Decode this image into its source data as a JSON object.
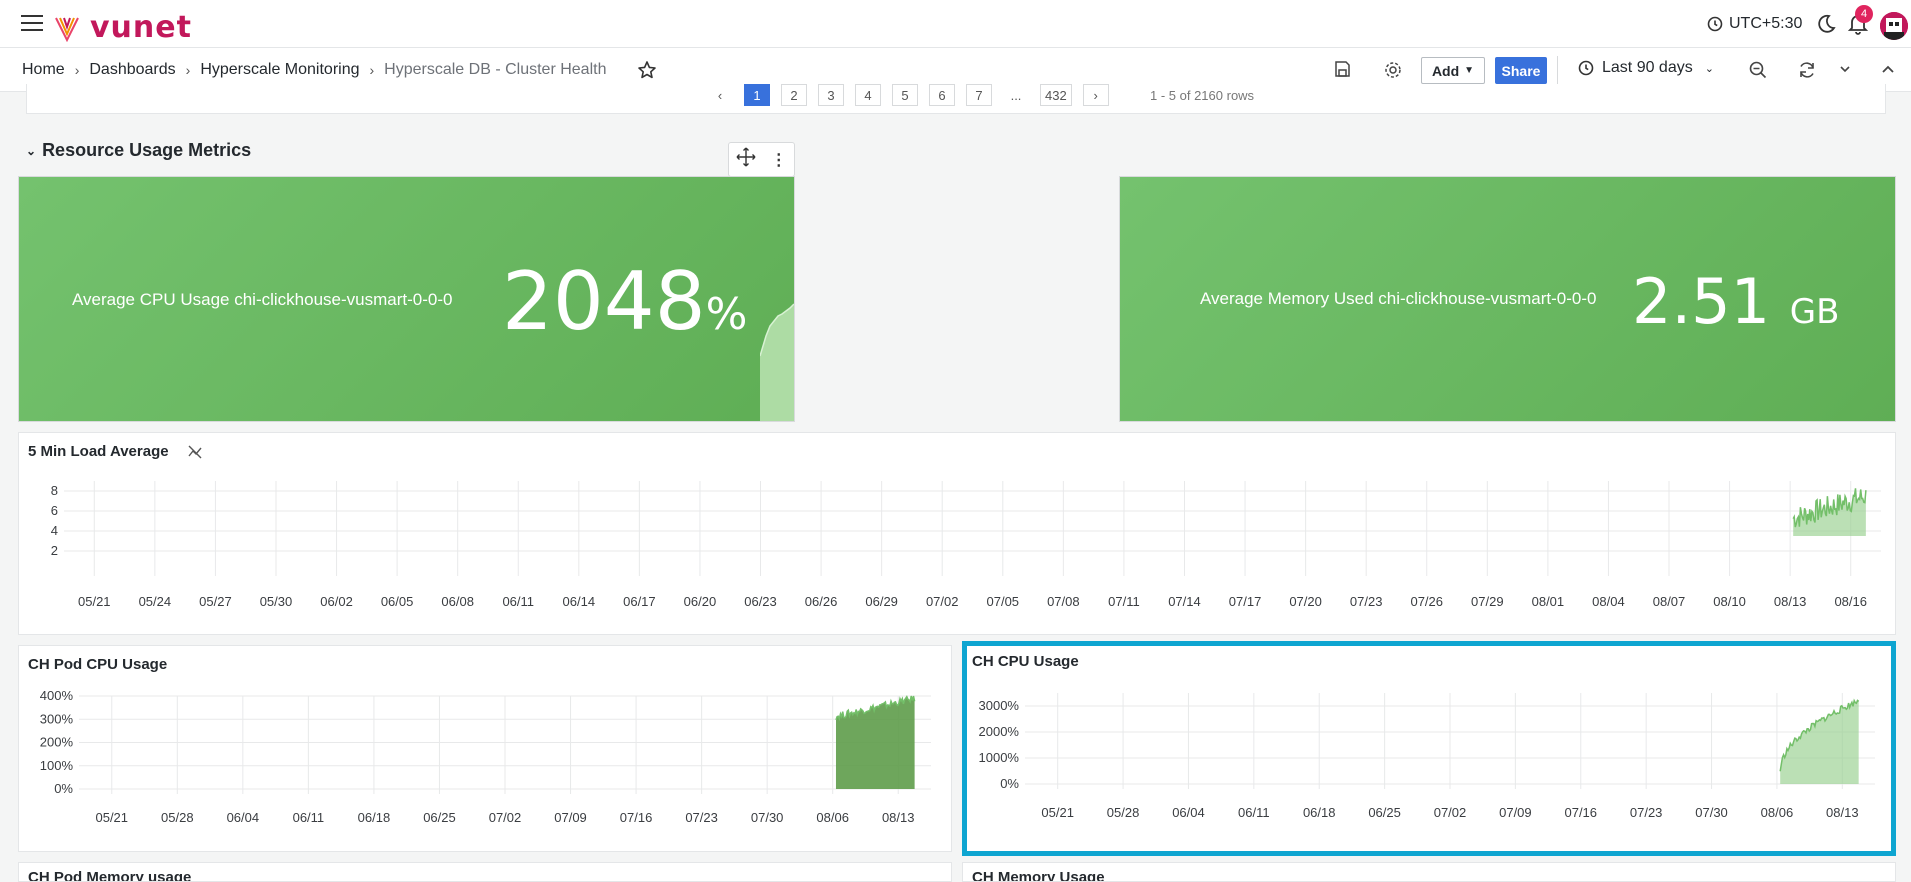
{
  "app": {
    "brand": "vunet",
    "timezone": "UTC+5:30",
    "notifications": "4"
  },
  "breadcrumb": [
    "Home",
    "Dashboards",
    "Hyperscale Monitoring",
    "Hyperscale DB - Cluster Health"
  ],
  "toolbar": {
    "add_label": "Add",
    "share_label": "Share",
    "time_range": "Last 90 days"
  },
  "pagination": {
    "pages": [
      "1",
      "2",
      "3",
      "4",
      "5",
      "6",
      "7",
      "...",
      "432"
    ],
    "active": "1",
    "rows_info": "1 - 5 of 2160 rows"
  },
  "row": {
    "title": "Resource Usage Metrics"
  },
  "stats": [
    {
      "label": "Average CPU Usage chi-clickhouse-vusmart-0-0-0",
      "value": "2048",
      "unit": "%"
    },
    {
      "label": "Average Memory Used chi-clickhouse-vusmart-0-0-0",
      "value": "2.51",
      "unit": "GB"
    }
  ],
  "panels": {
    "load": {
      "title": "5 Min Load Average"
    },
    "pod_cpu": {
      "title": "CH Pod CPU Usage"
    },
    "ch_cpu": {
      "title": "CH CPU Usage"
    },
    "pod_mem": {
      "title": "CH Pod Memory usage"
    },
    "ch_mem": {
      "title": "CH Memory Usage"
    }
  },
  "colors": {
    "accent": "#3871dc",
    "series": "#73bf69",
    "stat_bg": "#6ab862",
    "highlight": "#0ea5d1",
    "brand": "#c2185b"
  },
  "chart_data": [
    {
      "type": "area",
      "title": "5 Min Load Average",
      "x": [
        "05/21",
        "05/24",
        "05/27",
        "05/30",
        "06/02",
        "06/05",
        "06/08",
        "06/11",
        "06/14",
        "06/17",
        "06/20",
        "06/23",
        "06/26",
        "06/29",
        "07/02",
        "07/05",
        "07/08",
        "07/11",
        "07/14",
        "07/17",
        "07/20",
        "07/23",
        "07/26",
        "07/29",
        "08/01",
        "08/04",
        "08/07",
        "08/10",
        "08/13",
        "08/16"
      ],
      "yticks": [
        2,
        4,
        6,
        8
      ],
      "ylim": [
        0,
        9
      ],
      "series_region": {
        "start": "08/14",
        "end": "08/18",
        "low": 3.5,
        "high": 8.5
      },
      "grid": true
    },
    {
      "type": "area",
      "title": "CH Pod CPU Usage",
      "x": [
        "05/21",
        "05/28",
        "06/04",
        "06/11",
        "06/18",
        "06/25",
        "07/02",
        "07/09",
        "07/16",
        "07/23",
        "07/30",
        "08/06",
        "08/13"
      ],
      "yticks": [
        "0%",
        "100%",
        "200%",
        "300%",
        "400%"
      ],
      "ylim": [
        0,
        400
      ],
      "series_region": {
        "start": "08/14",
        "end": "08/18",
        "low": 0,
        "high": 390
      },
      "grid": true
    },
    {
      "type": "area",
      "title": "CH CPU Usage",
      "x": [
        "05/21",
        "05/28",
        "06/04",
        "06/11",
        "06/18",
        "06/25",
        "07/02",
        "07/09",
        "07/16",
        "07/23",
        "07/30",
        "08/06",
        "08/13"
      ],
      "yticks": [
        "0%",
        "1000%",
        "2000%",
        "3000%"
      ],
      "ylim": [
        0,
        3500
      ],
      "series_region": {
        "start": "08/14",
        "end": "08/18",
        "low": 0,
        "high": 3200
      },
      "grid": true
    }
  ]
}
